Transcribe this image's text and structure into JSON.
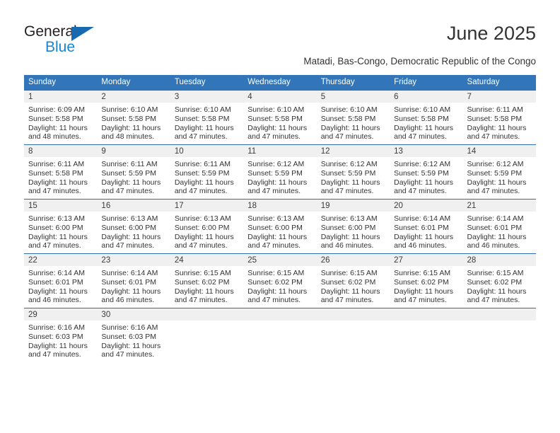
{
  "brand": {
    "name_top": "General",
    "name_bottom": "Blue",
    "accent_color": "#1a84d0",
    "triangle_color": "#1769b0"
  },
  "header": {
    "title": "June 2025",
    "subtitle": "Matadi, Bas-Congo, Democratic Republic of the Congo"
  },
  "calendar": {
    "header_bg": "#3275b8",
    "row_border": "#2f6fae",
    "daynum_bg": "#f0f0f0",
    "weekdays": [
      "Sunday",
      "Monday",
      "Tuesday",
      "Wednesday",
      "Thursday",
      "Friday",
      "Saturday"
    ],
    "weeks": [
      [
        {
          "day": "1",
          "sunrise": "Sunrise: 6:09 AM",
          "sunset": "Sunset: 5:58 PM",
          "daylight1": "Daylight: 11 hours",
          "daylight2": "and 48 minutes."
        },
        {
          "day": "2",
          "sunrise": "Sunrise: 6:10 AM",
          "sunset": "Sunset: 5:58 PM",
          "daylight1": "Daylight: 11 hours",
          "daylight2": "and 48 minutes."
        },
        {
          "day": "3",
          "sunrise": "Sunrise: 6:10 AM",
          "sunset": "Sunset: 5:58 PM",
          "daylight1": "Daylight: 11 hours",
          "daylight2": "and 47 minutes."
        },
        {
          "day": "4",
          "sunrise": "Sunrise: 6:10 AM",
          "sunset": "Sunset: 5:58 PM",
          "daylight1": "Daylight: 11 hours",
          "daylight2": "and 47 minutes."
        },
        {
          "day": "5",
          "sunrise": "Sunrise: 6:10 AM",
          "sunset": "Sunset: 5:58 PM",
          "daylight1": "Daylight: 11 hours",
          "daylight2": "and 47 minutes."
        },
        {
          "day": "6",
          "sunrise": "Sunrise: 6:10 AM",
          "sunset": "Sunset: 5:58 PM",
          "daylight1": "Daylight: 11 hours",
          "daylight2": "and 47 minutes."
        },
        {
          "day": "7",
          "sunrise": "Sunrise: 6:11 AM",
          "sunset": "Sunset: 5:58 PM",
          "daylight1": "Daylight: 11 hours",
          "daylight2": "and 47 minutes."
        }
      ],
      [
        {
          "day": "8",
          "sunrise": "Sunrise: 6:11 AM",
          "sunset": "Sunset: 5:58 PM",
          "daylight1": "Daylight: 11 hours",
          "daylight2": "and 47 minutes."
        },
        {
          "day": "9",
          "sunrise": "Sunrise: 6:11 AM",
          "sunset": "Sunset: 5:59 PM",
          "daylight1": "Daylight: 11 hours",
          "daylight2": "and 47 minutes."
        },
        {
          "day": "10",
          "sunrise": "Sunrise: 6:11 AM",
          "sunset": "Sunset: 5:59 PM",
          "daylight1": "Daylight: 11 hours",
          "daylight2": "and 47 minutes."
        },
        {
          "day": "11",
          "sunrise": "Sunrise: 6:12 AM",
          "sunset": "Sunset: 5:59 PM",
          "daylight1": "Daylight: 11 hours",
          "daylight2": "and 47 minutes."
        },
        {
          "day": "12",
          "sunrise": "Sunrise: 6:12 AM",
          "sunset": "Sunset: 5:59 PM",
          "daylight1": "Daylight: 11 hours",
          "daylight2": "and 47 minutes."
        },
        {
          "day": "13",
          "sunrise": "Sunrise: 6:12 AM",
          "sunset": "Sunset: 5:59 PM",
          "daylight1": "Daylight: 11 hours",
          "daylight2": "and 47 minutes."
        },
        {
          "day": "14",
          "sunrise": "Sunrise: 6:12 AM",
          "sunset": "Sunset: 5:59 PM",
          "daylight1": "Daylight: 11 hours",
          "daylight2": "and 47 minutes."
        }
      ],
      [
        {
          "day": "15",
          "sunrise": "Sunrise: 6:13 AM",
          "sunset": "Sunset: 6:00 PM",
          "daylight1": "Daylight: 11 hours",
          "daylight2": "and 47 minutes."
        },
        {
          "day": "16",
          "sunrise": "Sunrise: 6:13 AM",
          "sunset": "Sunset: 6:00 PM",
          "daylight1": "Daylight: 11 hours",
          "daylight2": "and 47 minutes."
        },
        {
          "day": "17",
          "sunrise": "Sunrise: 6:13 AM",
          "sunset": "Sunset: 6:00 PM",
          "daylight1": "Daylight: 11 hours",
          "daylight2": "and 47 minutes."
        },
        {
          "day": "18",
          "sunrise": "Sunrise: 6:13 AM",
          "sunset": "Sunset: 6:00 PM",
          "daylight1": "Daylight: 11 hours",
          "daylight2": "and 47 minutes."
        },
        {
          "day": "19",
          "sunrise": "Sunrise: 6:13 AM",
          "sunset": "Sunset: 6:00 PM",
          "daylight1": "Daylight: 11 hours",
          "daylight2": "and 46 minutes."
        },
        {
          "day": "20",
          "sunrise": "Sunrise: 6:14 AM",
          "sunset": "Sunset: 6:01 PM",
          "daylight1": "Daylight: 11 hours",
          "daylight2": "and 46 minutes."
        },
        {
          "day": "21",
          "sunrise": "Sunrise: 6:14 AM",
          "sunset": "Sunset: 6:01 PM",
          "daylight1": "Daylight: 11 hours",
          "daylight2": "and 46 minutes."
        }
      ],
      [
        {
          "day": "22",
          "sunrise": "Sunrise: 6:14 AM",
          "sunset": "Sunset: 6:01 PM",
          "daylight1": "Daylight: 11 hours",
          "daylight2": "and 46 minutes."
        },
        {
          "day": "23",
          "sunrise": "Sunrise: 6:14 AM",
          "sunset": "Sunset: 6:01 PM",
          "daylight1": "Daylight: 11 hours",
          "daylight2": "and 46 minutes."
        },
        {
          "day": "24",
          "sunrise": "Sunrise: 6:15 AM",
          "sunset": "Sunset: 6:02 PM",
          "daylight1": "Daylight: 11 hours",
          "daylight2": "and 47 minutes."
        },
        {
          "day": "25",
          "sunrise": "Sunrise: 6:15 AM",
          "sunset": "Sunset: 6:02 PM",
          "daylight1": "Daylight: 11 hours",
          "daylight2": "and 47 minutes."
        },
        {
          "day": "26",
          "sunrise": "Sunrise: 6:15 AM",
          "sunset": "Sunset: 6:02 PM",
          "daylight1": "Daylight: 11 hours",
          "daylight2": "and 47 minutes."
        },
        {
          "day": "27",
          "sunrise": "Sunrise: 6:15 AM",
          "sunset": "Sunset: 6:02 PM",
          "daylight1": "Daylight: 11 hours",
          "daylight2": "and 47 minutes."
        },
        {
          "day": "28",
          "sunrise": "Sunrise: 6:15 AM",
          "sunset": "Sunset: 6:02 PM",
          "daylight1": "Daylight: 11 hours",
          "daylight2": "and 47 minutes."
        }
      ],
      [
        {
          "day": "29",
          "sunrise": "Sunrise: 6:16 AM",
          "sunset": "Sunset: 6:03 PM",
          "daylight1": "Daylight: 11 hours",
          "daylight2": "and 47 minutes."
        },
        {
          "day": "30",
          "sunrise": "Sunrise: 6:16 AM",
          "sunset": "Sunset: 6:03 PM",
          "daylight1": "Daylight: 11 hours",
          "daylight2": "and 47 minutes."
        },
        {
          "day": "",
          "sunrise": "",
          "sunset": "",
          "daylight1": "",
          "daylight2": ""
        },
        {
          "day": "",
          "sunrise": "",
          "sunset": "",
          "daylight1": "",
          "daylight2": ""
        },
        {
          "day": "",
          "sunrise": "",
          "sunset": "",
          "daylight1": "",
          "daylight2": ""
        },
        {
          "day": "",
          "sunrise": "",
          "sunset": "",
          "daylight1": "",
          "daylight2": ""
        },
        {
          "day": "",
          "sunrise": "",
          "sunset": "",
          "daylight1": "",
          "daylight2": ""
        }
      ]
    ]
  }
}
